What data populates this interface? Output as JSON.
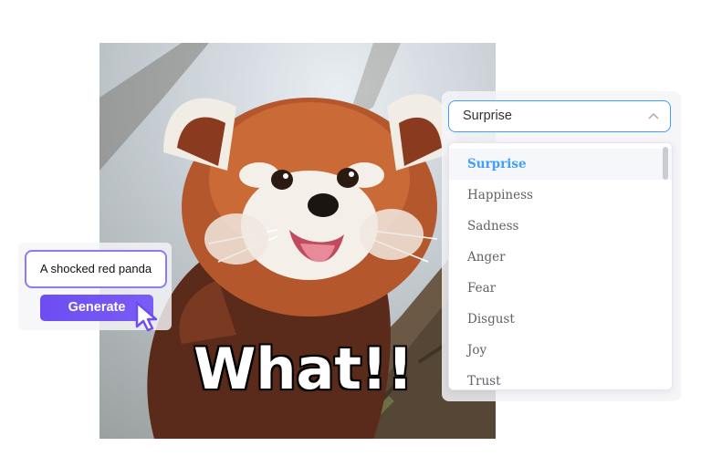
{
  "photo": {
    "subject": "red panda",
    "caption": "What!!"
  },
  "prompt": {
    "input_value": "A shocked red panda",
    "generate_label": "Generate"
  },
  "emotion_select": {
    "selected_value": "Surprise",
    "options": [
      {
        "label": "Surprise",
        "selected": true
      },
      {
        "label": "Happiness",
        "selected": false
      },
      {
        "label": "Sadness",
        "selected": false
      },
      {
        "label": "Anger",
        "selected": false
      },
      {
        "label": "Fear",
        "selected": false
      },
      {
        "label": "Disgust",
        "selected": false
      },
      {
        "label": "Joy",
        "selected": false
      },
      {
        "label": "Trust",
        "selected": false
      }
    ]
  },
  "colors": {
    "accent_blue": "#409eff",
    "button_purple": "#6d4df2",
    "input_border": "#8b7cf6"
  },
  "icons": [
    "pointer-cursor-icon",
    "chevron-up-icon"
  ]
}
